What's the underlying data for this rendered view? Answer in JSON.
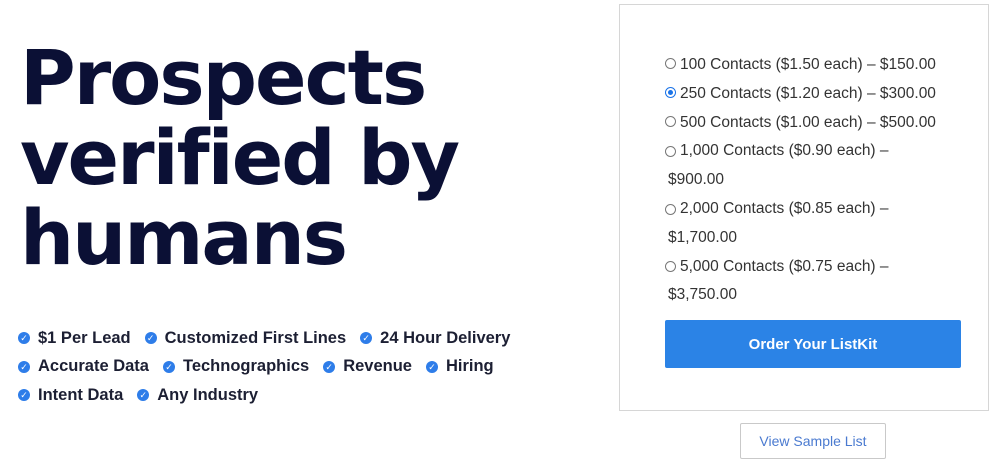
{
  "hero": {
    "title_lines": [
      "Prospects",
      "verified by",
      "humans"
    ]
  },
  "features": {
    "row1": [
      "$1 Per Lead",
      "Customized First Lines",
      "24 Hour Delivery"
    ],
    "row2": [
      "Accurate Data",
      "Technographics",
      "Revenue",
      "Hiring"
    ],
    "row3": [
      "Intent Data",
      "Any Industry"
    ]
  },
  "pricing": {
    "selected_index": 1,
    "options": [
      {
        "label": "100 Contacts ($1.50 each) – $150.00",
        "line1": "100 Contacts ($1.50 each) – $150.00",
        "line2": ""
      },
      {
        "label": "250 Contacts ($1.20 each) – $300.00",
        "line1": "250 Contacts ($1.20 each) – $300.00",
        "line2": ""
      },
      {
        "label": "500 Contacts ($1.00 each) – $500.00",
        "line1": "500 Contacts ($1.00 each) – $500.00",
        "line2": ""
      },
      {
        "label": "1,000 Contacts ($0.90 each) – $900.00",
        "line1": "1,000 Contacts ($0.90 each) –",
        "line2": "$900.00"
      },
      {
        "label": "2,000 Contacts ($0.85 each) – $1,700.00",
        "line1": "2,000 Contacts ($0.85 each) –",
        "line2": "$1,700.00"
      },
      {
        "label": "5,000 Contacts ($0.75 each) – $3,750.00",
        "line1": "5,000 Contacts ($0.75 each) –",
        "line2": "$3,750.00"
      }
    ]
  },
  "buttons": {
    "order_label": "Order Your ListKit",
    "sample_label": "View Sample List"
  },
  "colors": {
    "title": "#0b1035",
    "accent": "#2b83e6",
    "check": "#2e7de9"
  },
  "icons": {
    "feature_check": "check-circle-icon"
  }
}
